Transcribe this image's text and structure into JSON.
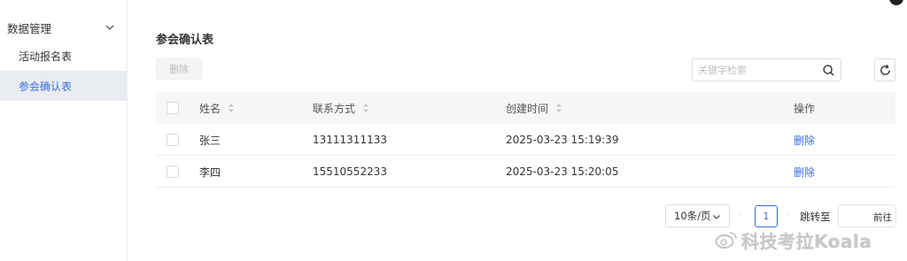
{
  "sidebar": {
    "group_label": "数据管理",
    "items": [
      {
        "label": "活动报名表",
        "active": false
      },
      {
        "label": "参会确认表",
        "active": true
      }
    ]
  },
  "main": {
    "title": "参会确认表",
    "toolbar": {
      "delete_label": "删除",
      "search_placeholder": "关键字检索"
    },
    "table": {
      "columns": [
        "姓名",
        "联系方式",
        "创建时间",
        "操作"
      ],
      "rows": [
        {
          "name": "张三",
          "phone": "13111311133",
          "created": "2025-03-23 15:19:39",
          "action": "删除"
        },
        {
          "name": "李四",
          "phone": "15510552233",
          "created": "2025-03-23 15:20:05",
          "action": "删除"
        }
      ]
    },
    "pagination": {
      "page_size_label": "10条/页",
      "current_page": "1",
      "jump_label": "跳转至",
      "go_label": "前往"
    }
  },
  "watermark": {
    "text": "科技考拉Koala"
  },
  "colors": {
    "accent": "#3b6ed8",
    "sidebar_active_bg": "#e9ecf1",
    "table_header_bg": "#f5f6f8"
  }
}
